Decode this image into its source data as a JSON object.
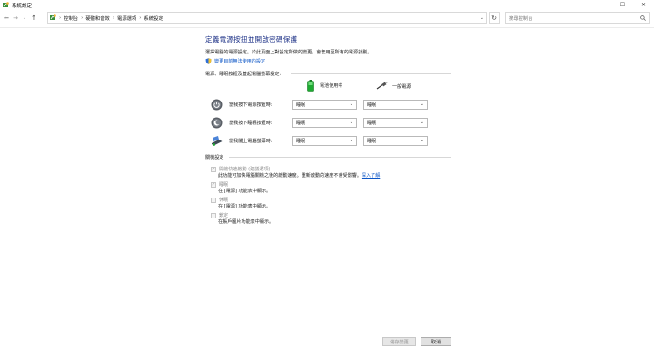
{
  "window": {
    "title": "系統設定",
    "minimize_glyph": "—",
    "maximize_glyph": "☐",
    "close_glyph": "✕"
  },
  "nav": {
    "back_glyph": "←",
    "forward_glyph": "→",
    "recent_glyph": "⌄",
    "up_glyph": "↑",
    "breadcrumb": [
      "控制台",
      "硬體和音效",
      "電源選項",
      "系統設定"
    ],
    "separator": "›",
    "refresh_glyph": "↻",
    "search_placeholder": "搜尋控制台"
  },
  "main": {
    "title": "定義電源按鈕並開啟密碼保護",
    "description": "選擇電腦的電源設定。於此頁面上對設定所做的變更，會套用至所有的電源計劃。",
    "admin_link": "變更目前無法使用的設定",
    "power_section_label": "電源、睡眠按鈕及蓋起電腦螢幕設定:",
    "battery_column": "電池使用中",
    "plugged_column": "一般電源",
    "rows": [
      {
        "label": "當我按下電源按鈕時:",
        "icon": "power-icon",
        "battery_value": "睡眠",
        "plugged_value": "睡眠"
      },
      {
        "label": "當我按下睡眠按鈕時:",
        "icon": "sleep-icon",
        "battery_value": "睡眠",
        "plugged_value": "睡眠"
      },
      {
        "label": "當我闔上電腦螢幕時:",
        "icon": "laptop-lid-icon",
        "battery_value": "睡眠",
        "plugged_value": "睡眠"
      }
    ],
    "shutdown_section_label": "關機設定",
    "shutdown_options": [
      {
        "label": "開啟快速啟動 (建議選項)",
        "checked": true,
        "description": "此功能可加快電腦關機之後的啟動速度。重新啟動的速度不會受影響。",
        "link": "深入了解"
      },
      {
        "label": "睡眠",
        "checked": true,
        "description": "在 [電源] 功能表中顯示。",
        "link": ""
      },
      {
        "label": "休眠",
        "checked": false,
        "description": "在 [電源] 功能表中顯示。",
        "link": ""
      },
      {
        "label": "鎖定",
        "checked": false,
        "description": "在帳戶圖片功能表中顯示。",
        "link": ""
      }
    ]
  },
  "footer": {
    "save_label": "儲存變更",
    "cancel_label": "取消"
  },
  "colors": {
    "title_blue": "#1e3287",
    "link_blue": "#0b55c6",
    "battery_green": "#1faa32"
  }
}
